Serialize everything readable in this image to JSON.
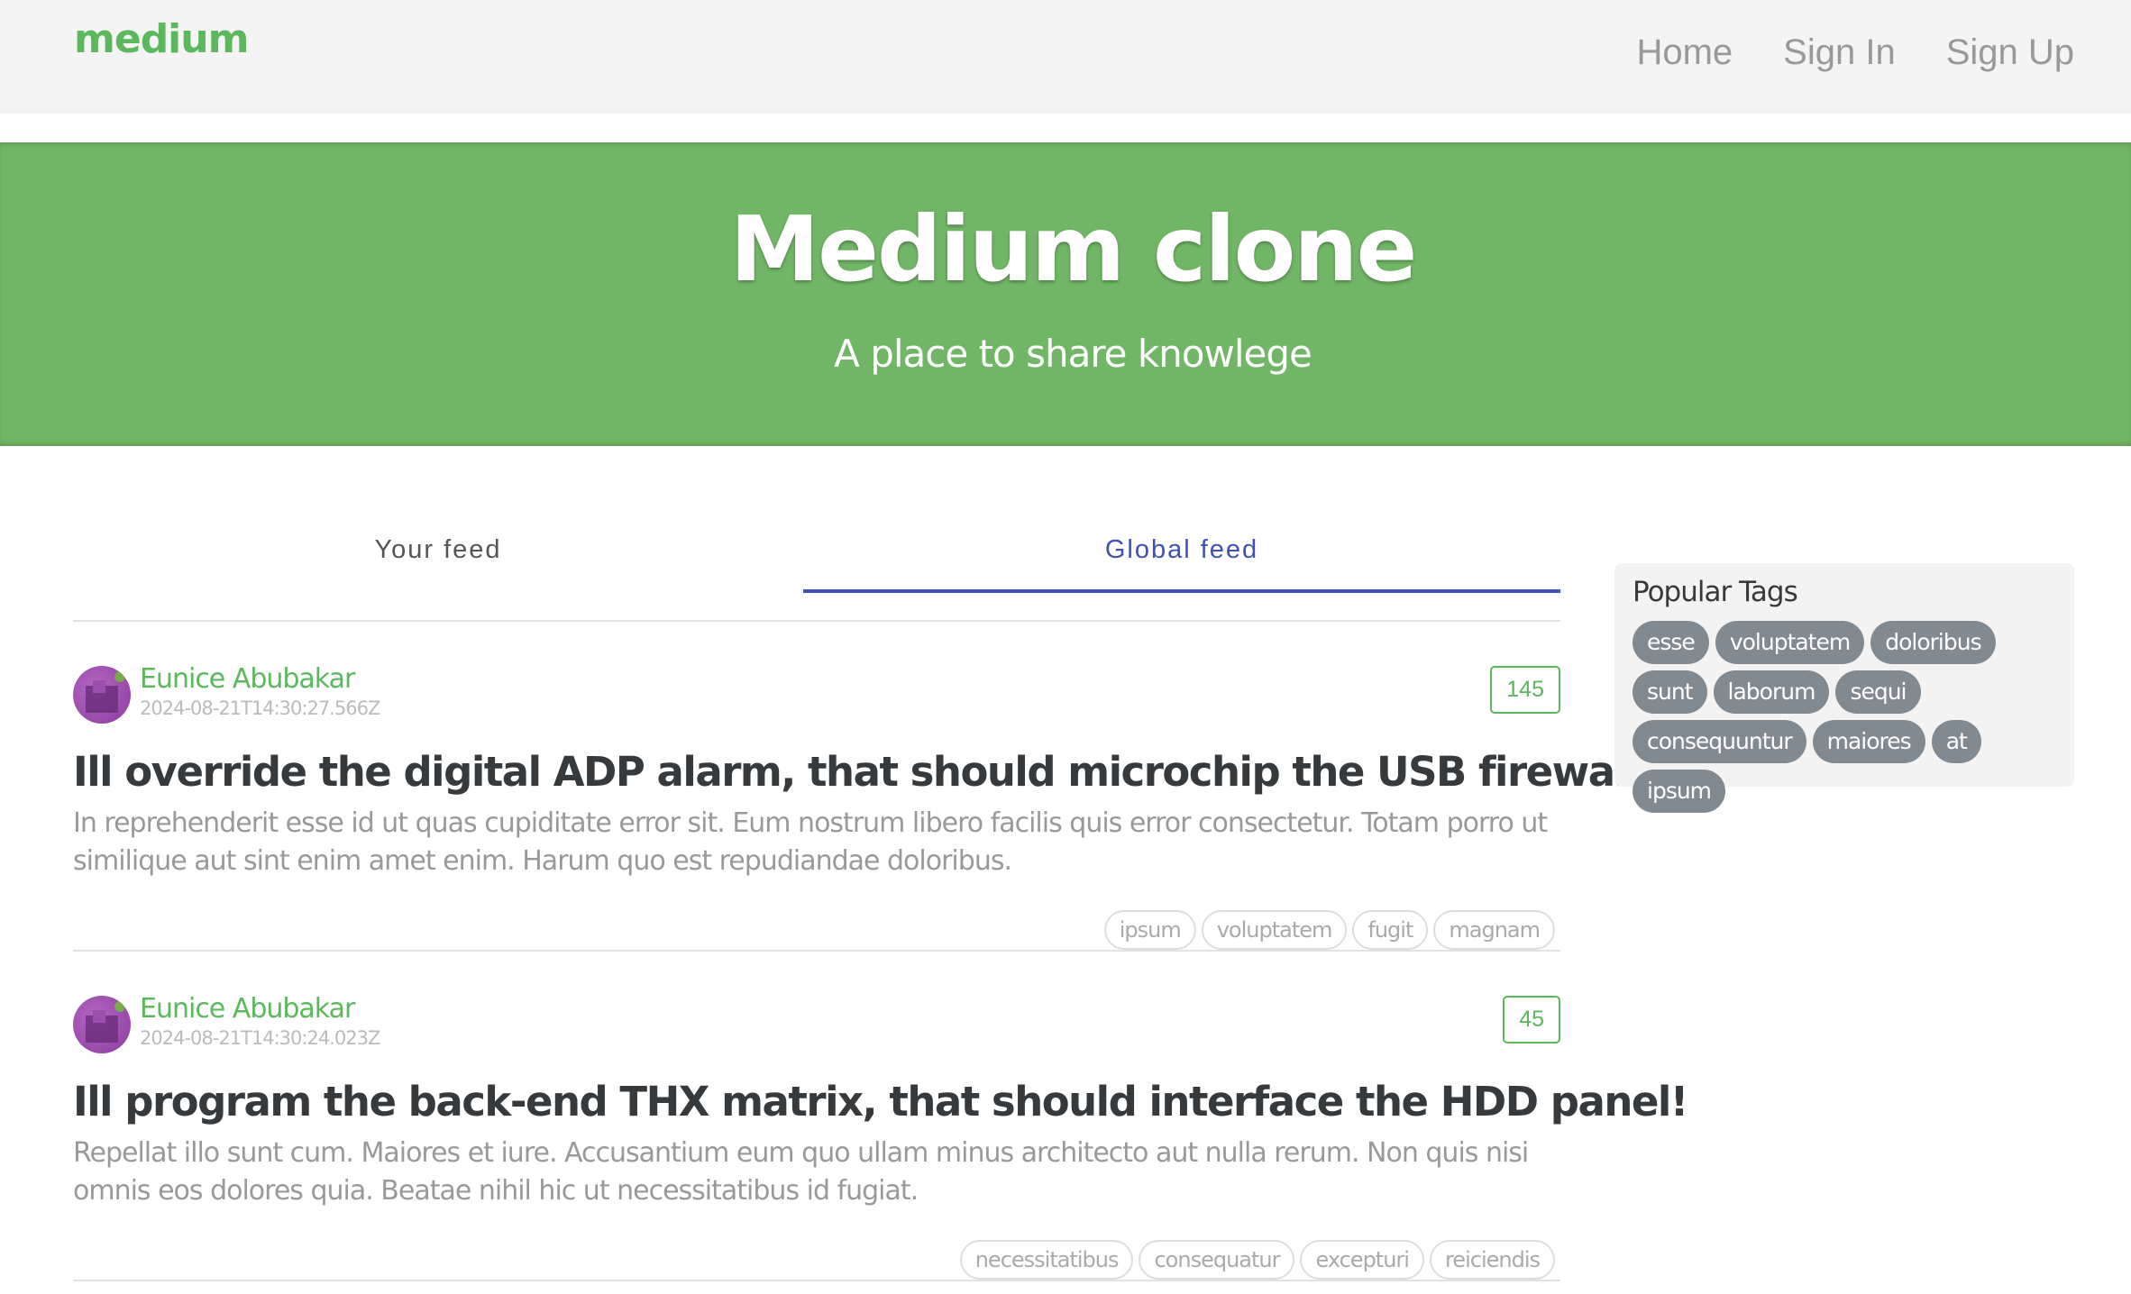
{
  "navbar": {
    "brand": "medium",
    "links": [
      "Home",
      "Sign In",
      "Sign Up"
    ]
  },
  "banner": {
    "title": "Medium clone",
    "subtitle": "A place to share knowlege"
  },
  "tabs": {
    "your_feed": "Your feed",
    "global_feed": "Global feed",
    "active": "global_feed"
  },
  "articles": [
    {
      "author": "Eunice Abubakar",
      "date": "2024-08-21T14:30:27.566Z",
      "likes": "145",
      "title": "Ill override the digital ADP alarm, that should microchip the USB firewall!",
      "description": "In reprehenderit esse id ut quas cupiditate error sit. Eum nostrum libero facilis quis error consectetur. Totam porro ut similique aut sint enim amet enim. Harum quo est repudiandae doloribus.",
      "tags": [
        "ipsum",
        "voluptatem",
        "fugit",
        "magnam"
      ]
    },
    {
      "author": "Eunice Abubakar",
      "date": "2024-08-21T14:30:24.023Z",
      "likes": "45",
      "title": "Ill program the back-end THX matrix, that should interface the HDD panel!",
      "description": "Repellat illo sunt cum. Maiores et iure. Accusantium eum quo ullam minus architecto aut nulla rerum. Non quis nisi omnis eos dolores quia. Beatae nihil hic ut necessitatibus id fugiat.",
      "tags": [
        "necessitatibus",
        "consequatur",
        "excepturi",
        "reiciendis"
      ]
    }
  ],
  "sidebar": {
    "title": "Popular Tags",
    "tags": [
      "esse",
      "voluptatem",
      "doloribus",
      "sunt",
      "laborum",
      "sequi",
      "consequuntur",
      "maiores",
      "at",
      "ipsum"
    ]
  },
  "colors": {
    "accent": "#5cb85c",
    "banner": "#71b566",
    "active_tab": "#3f51b5",
    "tag_pill": "#818a91"
  }
}
